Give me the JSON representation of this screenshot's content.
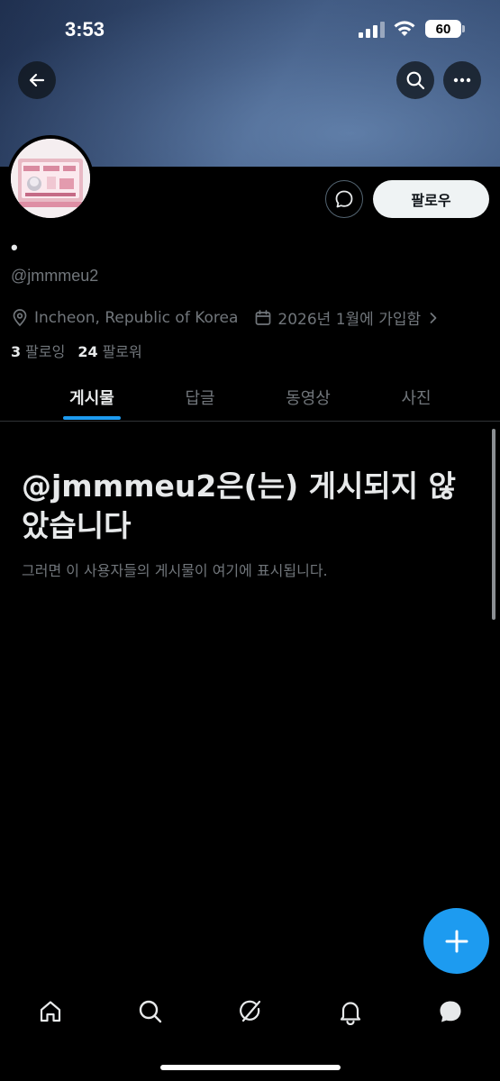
{
  "status_bar": {
    "time": "3:53",
    "battery": "60"
  },
  "profile": {
    "display_name": "•",
    "handle": "@jmmmeu2",
    "location": "Incheon, Republic of Korea",
    "joined": "2026년 1월에 가입함",
    "following_count": "3",
    "following_label": "팔로잉",
    "followers_count": "24",
    "followers_label": "팔로워"
  },
  "actions": {
    "follow_label": "팔로우"
  },
  "tabs": [
    {
      "label": "게시물",
      "active": true
    },
    {
      "label": "답글",
      "active": false
    },
    {
      "label": "동영상",
      "active": false
    },
    {
      "label": "사진",
      "active": false
    }
  ],
  "empty_state": {
    "title": "@jmmmeu2은(는) 게시되지 않았습니다",
    "subtitle": "그러면 이 사용자들의 게시물이 여기에 표시됩니다."
  },
  "colors": {
    "accent": "#1d9bf0",
    "background": "#000000",
    "muted": "#71767b"
  },
  "icons": {
    "back": "back-arrow-icon",
    "search": "search-icon",
    "more": "more-icon",
    "message": "message-icon",
    "location": "location-pin-icon",
    "calendar": "calendar-icon",
    "compose": "plus-icon",
    "nav": [
      "home-icon",
      "search-icon",
      "grok-icon",
      "bell-icon",
      "chat-icon"
    ]
  }
}
